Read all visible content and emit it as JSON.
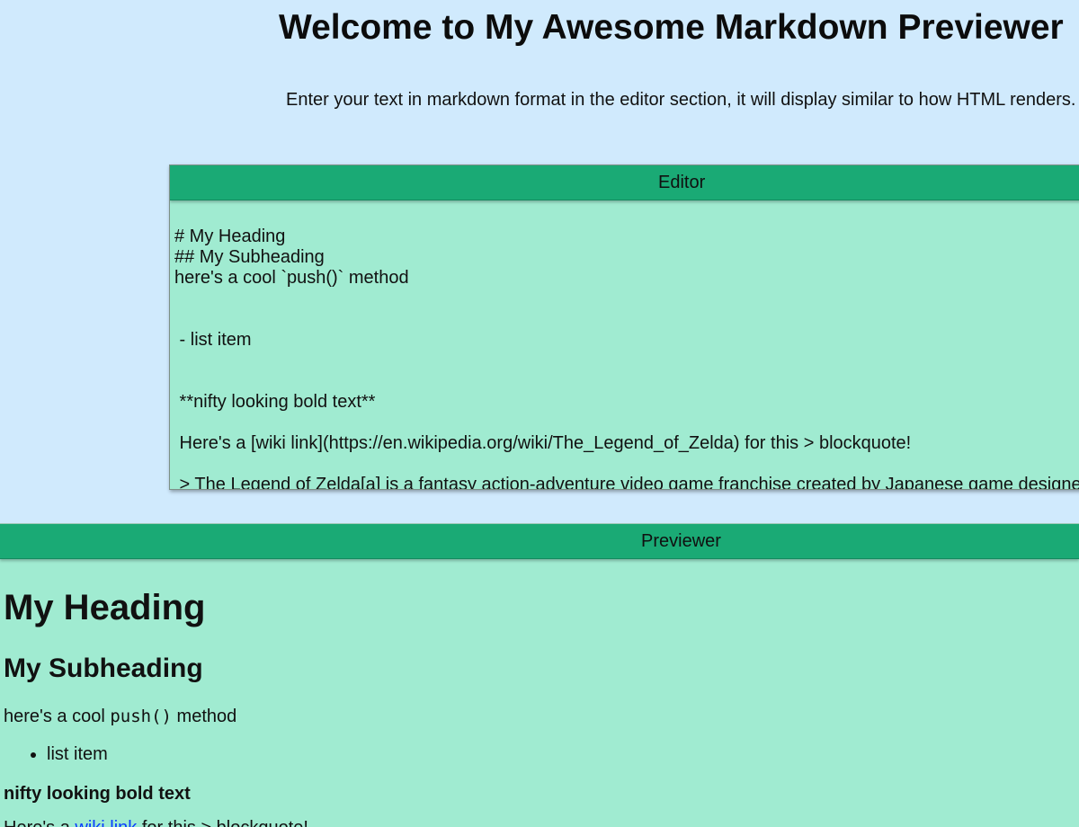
{
  "page": {
    "title": "Welcome to My Awesome Markdown Previewer",
    "subtitle": "Enter your text in markdown format in the editor section, it will display similar to how HTML renders."
  },
  "editor": {
    "header": "Editor",
    "content": "# My Heading\n## My Subheading\nhere's a cool `push()` method\n\n\n - list item\n\n\n **nifty looking bold text**\n\n Here's a [wiki link](https://en.wikipedia.org/wiki/The_Legend_of_Zelda) for this > blockquote!\n\n > The Legend of Zelda[a] is a fantasy action-adventure video game franchise created by Japanese game designers"
  },
  "previewer": {
    "header": "Previewer",
    "heading": "My Heading",
    "subheading": "My Subheading",
    "code_prefix": "here's a cool ",
    "code_text": "push()",
    "code_suffix": " method",
    "list_item": "list item",
    "bold_text": "nifty looking bold text",
    "link_prefix": "Here's a ",
    "link_text": "wiki link",
    "link_suffix": " for this > blockquote!"
  },
  "colors": {
    "page_background": "#d0eafd",
    "panel_header": "#1aaa75",
    "panel_body": "#a0ebd1",
    "link": "#0a3cff"
  }
}
